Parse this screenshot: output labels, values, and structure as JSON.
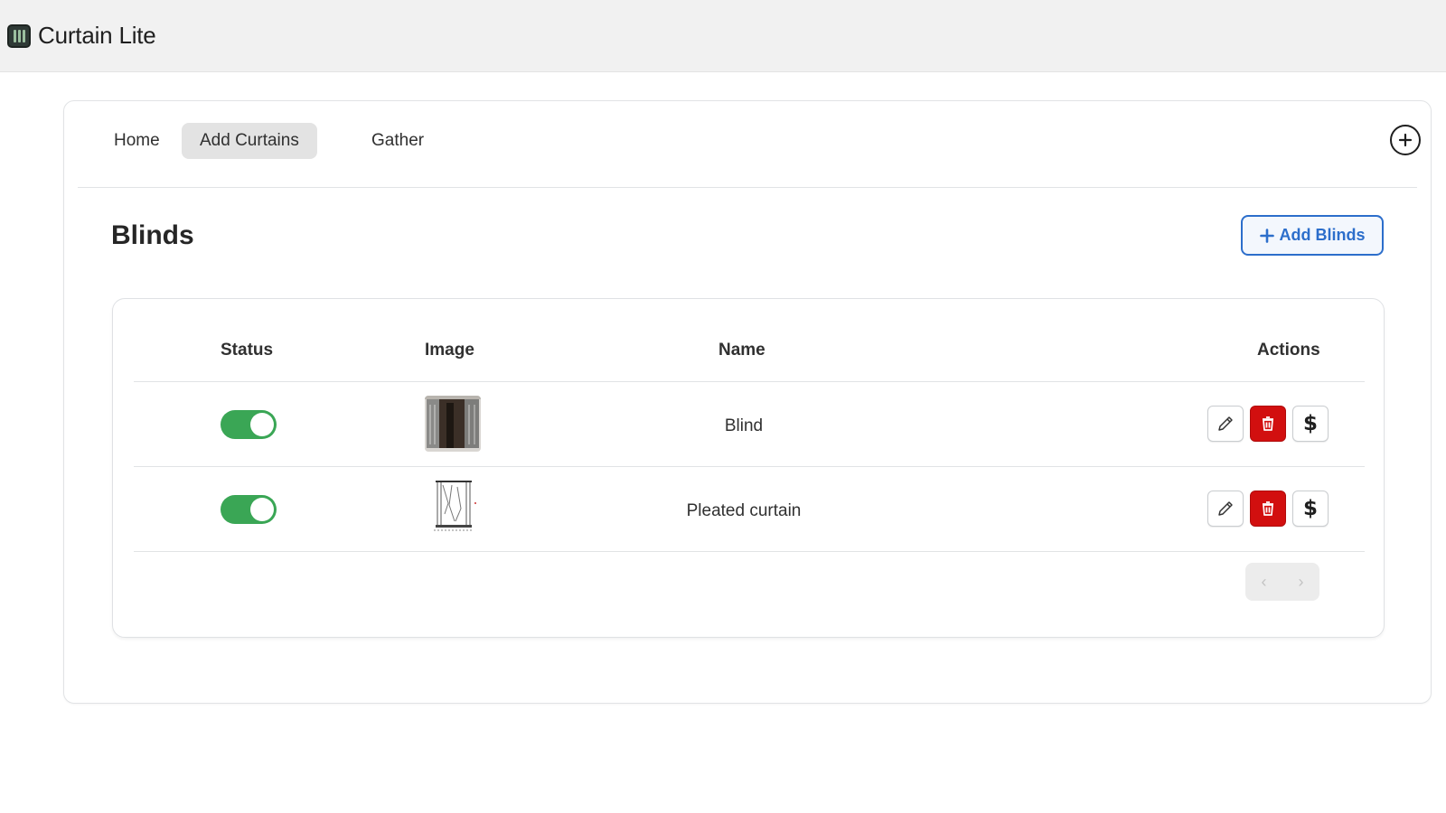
{
  "app": {
    "title": "Curtain Lite",
    "icon": "curtain-app-icon"
  },
  "nav": {
    "tabs": [
      {
        "label": "Home",
        "active": false
      },
      {
        "label": "Add Curtains",
        "active": true
      },
      {
        "label": "Gather",
        "active": false
      }
    ],
    "add_icon": "plus-circle-icon"
  },
  "section": {
    "title": "Blinds",
    "add_button_label": "Add Blinds"
  },
  "table": {
    "headers": {
      "status": "Status",
      "image": "Image",
      "name": "Name",
      "actions": "Actions"
    },
    "rows": [
      {
        "status_on": true,
        "image_icon": "curtain-photo",
        "name": "Blind"
      },
      {
        "status_on": true,
        "image_icon": "pleated-curtain-drawing",
        "name": "Pleated curtain"
      }
    ],
    "action_icons": [
      "pencil-icon",
      "trash-icon",
      "dollar-icon"
    ],
    "price_symbol": "$"
  },
  "pagination": {
    "prev_enabled": false,
    "next_enabled": false
  },
  "colors": {
    "accent": "#2c6ecb",
    "toggle_on": "#3aa655",
    "danger": "#d20f0f",
    "topbar": "#f1f1f1"
  }
}
